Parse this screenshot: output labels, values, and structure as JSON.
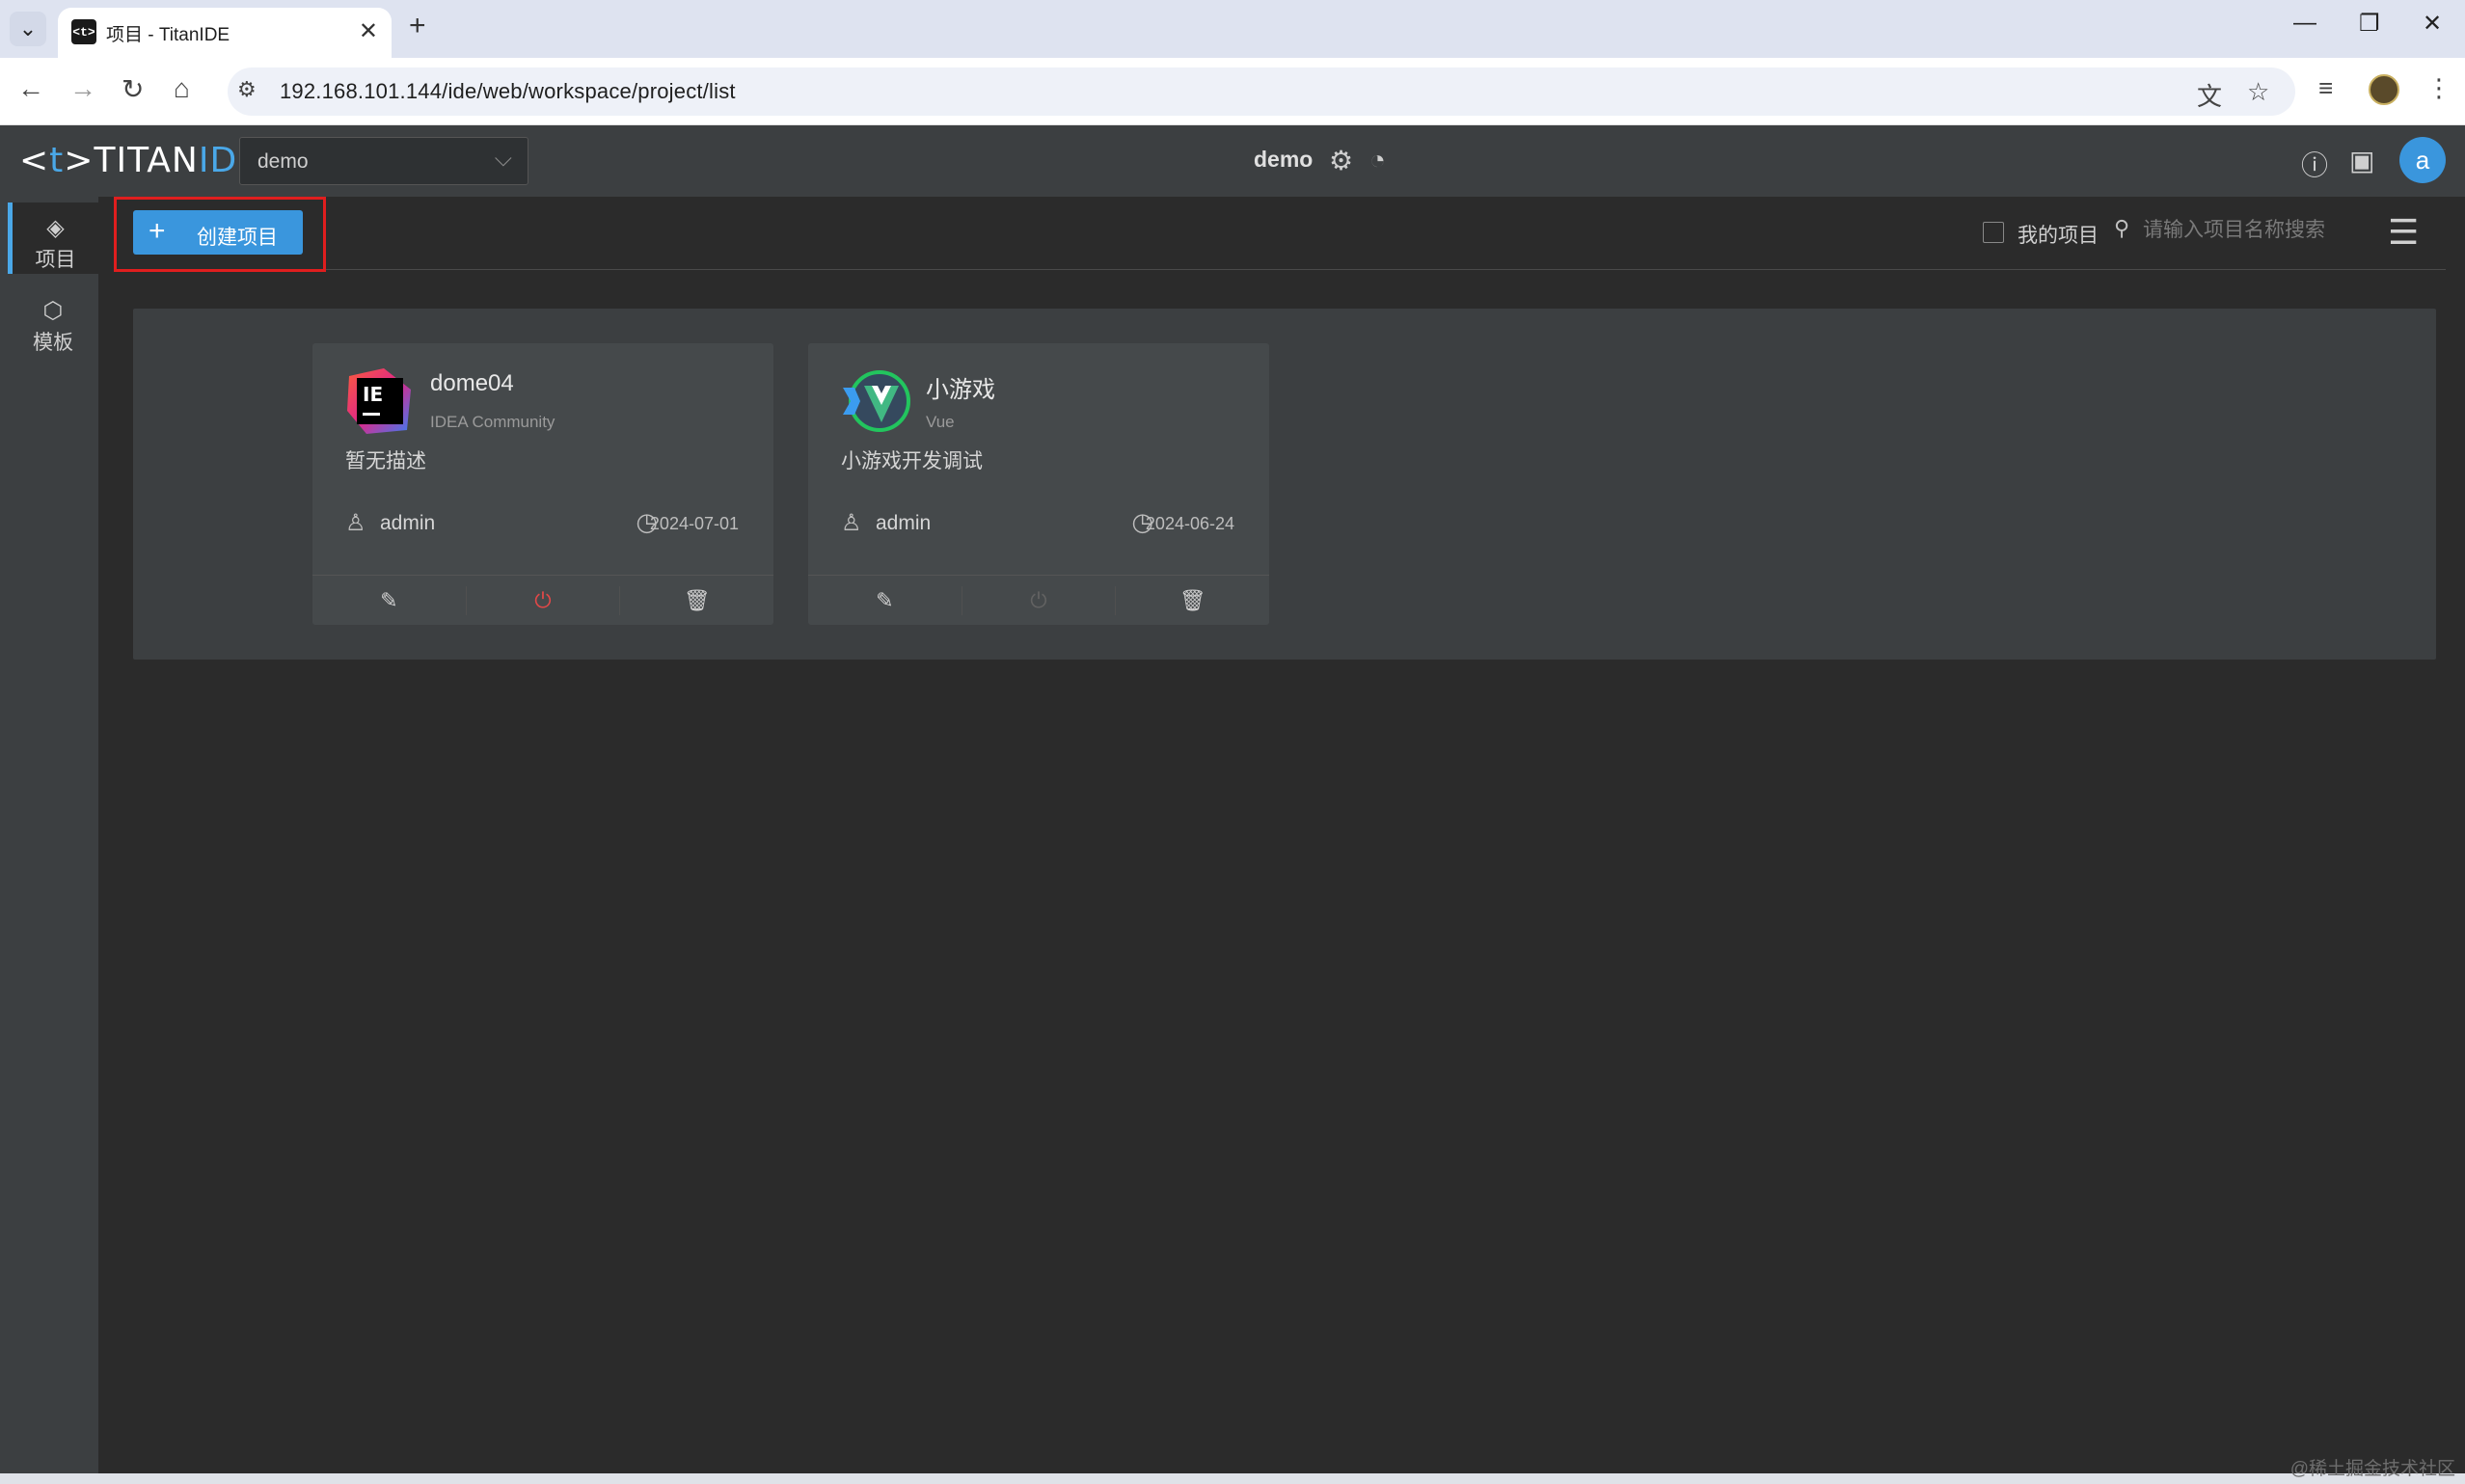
{
  "browser": {
    "tab_title": "项目 - TitanIDE",
    "tab_favicon_text": "<t>",
    "url": "192.168.101.144/ide/web/workspace/project/list"
  },
  "app": {
    "logo_open": "<",
    "logo_t": "t",
    "logo_close": ">",
    "logo_titan": "TITAN",
    "logo_ide": "IDE",
    "workspace_selected": "demo",
    "workspace_name": "demo",
    "user_initial": "a"
  },
  "sidebar": {
    "items": [
      {
        "label": "项目",
        "icon": "layers-icon",
        "active": true
      },
      {
        "label": "模板",
        "icon": "cube-icon",
        "active": false
      }
    ]
  },
  "toolbar": {
    "create_label": "创建项目",
    "my_projects_label": "我的项目",
    "search_placeholder": "请输入项目名称搜索"
  },
  "projects": [
    {
      "name": "dome04",
      "type": "IDEA Community",
      "description": "暂无描述",
      "owner": "admin",
      "date": "2024-07-01",
      "running": true
    },
    {
      "name": "小游戏",
      "type": "Vue",
      "description": "小游戏开发调试",
      "owner": "admin",
      "date": "2024-06-24",
      "running": false
    }
  ],
  "watermark": "@稀土掘金技术社区",
  "colors": {
    "accent": "#3a96dd",
    "header_bg": "#3c3f41",
    "page_bg": "#2b2b2b",
    "highlight_border": "#e01e1e",
    "power_active": "#e04848"
  }
}
